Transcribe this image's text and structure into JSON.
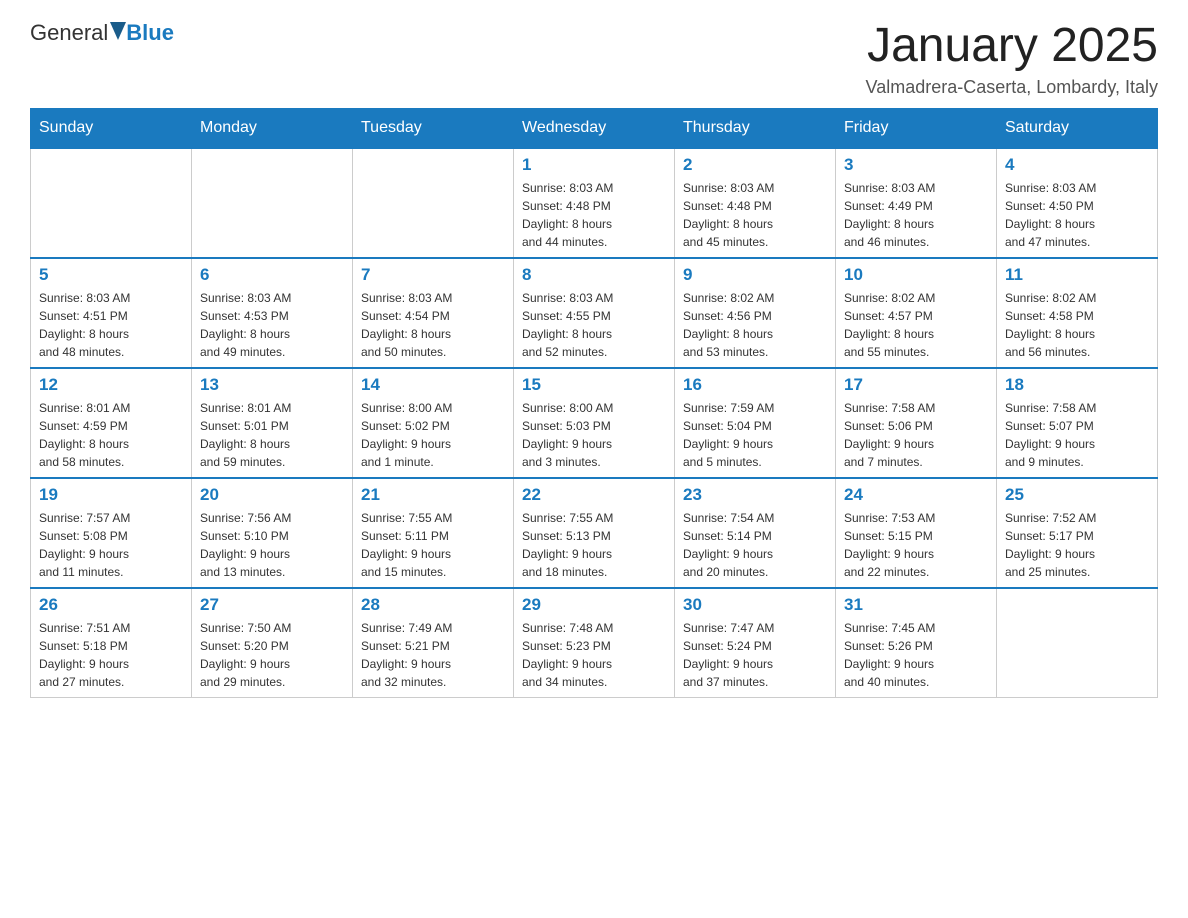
{
  "header": {
    "logo_text_general": "General",
    "logo_text_blue": "Blue",
    "month_title": "January 2025",
    "subtitle": "Valmadrera-Caserta, Lombardy, Italy"
  },
  "days_of_week": [
    "Sunday",
    "Monday",
    "Tuesday",
    "Wednesday",
    "Thursday",
    "Friday",
    "Saturday"
  ],
  "weeks": [
    [
      {
        "day": "",
        "info": ""
      },
      {
        "day": "",
        "info": ""
      },
      {
        "day": "",
        "info": ""
      },
      {
        "day": "1",
        "info": "Sunrise: 8:03 AM\nSunset: 4:48 PM\nDaylight: 8 hours\nand 44 minutes."
      },
      {
        "day": "2",
        "info": "Sunrise: 8:03 AM\nSunset: 4:48 PM\nDaylight: 8 hours\nand 45 minutes."
      },
      {
        "day": "3",
        "info": "Sunrise: 8:03 AM\nSunset: 4:49 PM\nDaylight: 8 hours\nand 46 minutes."
      },
      {
        "day": "4",
        "info": "Sunrise: 8:03 AM\nSunset: 4:50 PM\nDaylight: 8 hours\nand 47 minutes."
      }
    ],
    [
      {
        "day": "5",
        "info": "Sunrise: 8:03 AM\nSunset: 4:51 PM\nDaylight: 8 hours\nand 48 minutes."
      },
      {
        "day": "6",
        "info": "Sunrise: 8:03 AM\nSunset: 4:53 PM\nDaylight: 8 hours\nand 49 minutes."
      },
      {
        "day": "7",
        "info": "Sunrise: 8:03 AM\nSunset: 4:54 PM\nDaylight: 8 hours\nand 50 minutes."
      },
      {
        "day": "8",
        "info": "Sunrise: 8:03 AM\nSunset: 4:55 PM\nDaylight: 8 hours\nand 52 minutes."
      },
      {
        "day": "9",
        "info": "Sunrise: 8:02 AM\nSunset: 4:56 PM\nDaylight: 8 hours\nand 53 minutes."
      },
      {
        "day": "10",
        "info": "Sunrise: 8:02 AM\nSunset: 4:57 PM\nDaylight: 8 hours\nand 55 minutes."
      },
      {
        "day": "11",
        "info": "Sunrise: 8:02 AM\nSunset: 4:58 PM\nDaylight: 8 hours\nand 56 minutes."
      }
    ],
    [
      {
        "day": "12",
        "info": "Sunrise: 8:01 AM\nSunset: 4:59 PM\nDaylight: 8 hours\nand 58 minutes."
      },
      {
        "day": "13",
        "info": "Sunrise: 8:01 AM\nSunset: 5:01 PM\nDaylight: 8 hours\nand 59 minutes."
      },
      {
        "day": "14",
        "info": "Sunrise: 8:00 AM\nSunset: 5:02 PM\nDaylight: 9 hours\nand 1 minute."
      },
      {
        "day": "15",
        "info": "Sunrise: 8:00 AM\nSunset: 5:03 PM\nDaylight: 9 hours\nand 3 minutes."
      },
      {
        "day": "16",
        "info": "Sunrise: 7:59 AM\nSunset: 5:04 PM\nDaylight: 9 hours\nand 5 minutes."
      },
      {
        "day": "17",
        "info": "Sunrise: 7:58 AM\nSunset: 5:06 PM\nDaylight: 9 hours\nand 7 minutes."
      },
      {
        "day": "18",
        "info": "Sunrise: 7:58 AM\nSunset: 5:07 PM\nDaylight: 9 hours\nand 9 minutes."
      }
    ],
    [
      {
        "day": "19",
        "info": "Sunrise: 7:57 AM\nSunset: 5:08 PM\nDaylight: 9 hours\nand 11 minutes."
      },
      {
        "day": "20",
        "info": "Sunrise: 7:56 AM\nSunset: 5:10 PM\nDaylight: 9 hours\nand 13 minutes."
      },
      {
        "day": "21",
        "info": "Sunrise: 7:55 AM\nSunset: 5:11 PM\nDaylight: 9 hours\nand 15 minutes."
      },
      {
        "day": "22",
        "info": "Sunrise: 7:55 AM\nSunset: 5:13 PM\nDaylight: 9 hours\nand 18 minutes."
      },
      {
        "day": "23",
        "info": "Sunrise: 7:54 AM\nSunset: 5:14 PM\nDaylight: 9 hours\nand 20 minutes."
      },
      {
        "day": "24",
        "info": "Sunrise: 7:53 AM\nSunset: 5:15 PM\nDaylight: 9 hours\nand 22 minutes."
      },
      {
        "day": "25",
        "info": "Sunrise: 7:52 AM\nSunset: 5:17 PM\nDaylight: 9 hours\nand 25 minutes."
      }
    ],
    [
      {
        "day": "26",
        "info": "Sunrise: 7:51 AM\nSunset: 5:18 PM\nDaylight: 9 hours\nand 27 minutes."
      },
      {
        "day": "27",
        "info": "Sunrise: 7:50 AM\nSunset: 5:20 PM\nDaylight: 9 hours\nand 29 minutes."
      },
      {
        "day": "28",
        "info": "Sunrise: 7:49 AM\nSunset: 5:21 PM\nDaylight: 9 hours\nand 32 minutes."
      },
      {
        "day": "29",
        "info": "Sunrise: 7:48 AM\nSunset: 5:23 PM\nDaylight: 9 hours\nand 34 minutes."
      },
      {
        "day": "30",
        "info": "Sunrise: 7:47 AM\nSunset: 5:24 PM\nDaylight: 9 hours\nand 37 minutes."
      },
      {
        "day": "31",
        "info": "Sunrise: 7:45 AM\nSunset: 5:26 PM\nDaylight: 9 hours\nand 40 minutes."
      },
      {
        "day": "",
        "info": ""
      }
    ]
  ]
}
